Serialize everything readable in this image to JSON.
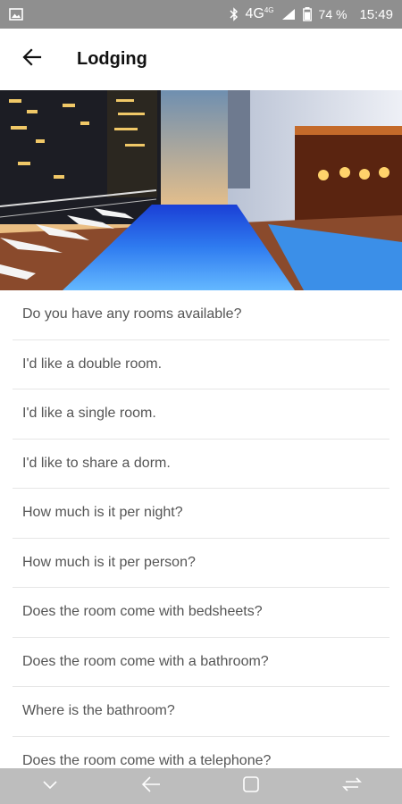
{
  "status_bar": {
    "network": "4G",
    "network_sup": "4G",
    "battery_percent": "74 %",
    "time": "15:49",
    "icons": [
      "image-icon",
      "bluetooth-icon",
      "signal-icon",
      "battery-icon"
    ]
  },
  "app_bar": {
    "title": "Lodging",
    "back_icon": "arrow-left-icon"
  },
  "hero": {
    "icon": "hotel-pool-image"
  },
  "phrases": [
    "Do you have any rooms available?",
    "I'd like a double room.",
    "I'd like a single room.",
    "I'd like to share a dorm.",
    "How much is it per night?",
    "How much is it per person?",
    "Does the room come with bedsheets?",
    "Does the room come with a bathroom?",
    "Where is the bathroom?",
    "Does the room come with a telephone?"
  ],
  "nav_bar": {
    "icons": [
      "chevron-down-icon",
      "back-arrow-icon",
      "home-square-icon",
      "recents-icon"
    ]
  }
}
